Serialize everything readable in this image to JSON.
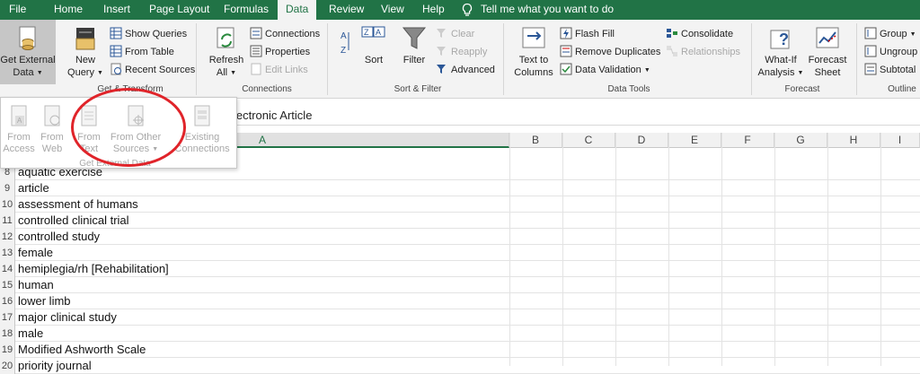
{
  "menu": {
    "tabs": [
      "File",
      "Home",
      "Insert",
      "Page Layout",
      "Formulas",
      "Data",
      "Review",
      "View",
      "Help"
    ],
    "active": "Data",
    "tell_me": "Tell me what you want to do"
  },
  "ribbon": {
    "get_external": {
      "line1": "Get External",
      "line2": "Data"
    },
    "new_query": {
      "line1": "New",
      "line2": "Query"
    },
    "show_queries": "Show Queries",
    "from_table": "From Table",
    "recent_sources": "Recent Sources",
    "group_get_transform": "Get & Transform",
    "refresh": {
      "line1": "Refresh",
      "line2": "All"
    },
    "connections": "Connections",
    "properties": "Properties",
    "edit_links": "Edit Links",
    "group_connections": "Connections",
    "sort_az": "A↓Z",
    "sort": "Sort",
    "filter": "Filter",
    "clear": "Clear",
    "reapply": "Reapply",
    "advanced": "Advanced",
    "group_sort_filter": "Sort & Filter",
    "text_to_columns": {
      "line1": "Text to",
      "line2": "Columns"
    },
    "flash_fill": "Flash Fill",
    "remove_duplicates": "Remove Duplicates",
    "data_validation": "Data Validation",
    "consolidate": "Consolidate",
    "relationships": "Relationships",
    "group_data_tools": "Data Tools",
    "what_if": {
      "line1": "What-If",
      "line2": "Analysis"
    },
    "forecast_sheet": {
      "line1": "Forecast",
      "line2": "Sheet"
    },
    "group_forecast": "Forecast",
    "group_btn": "Group",
    "ungroup_btn": "Ungroup",
    "subtotal_btn": "Subtotal",
    "group_outline": "Outline"
  },
  "dropdown": {
    "from_access": {
      "line1": "From",
      "line2": "Access"
    },
    "from_web": {
      "line1": "From",
      "line2": "Web"
    },
    "from_text": {
      "line1": "From",
      "line2": "Text"
    },
    "from_other": {
      "line1": "From Other",
      "line2": "Sources"
    },
    "existing": {
      "line1": "Existing",
      "line2": "Connections"
    },
    "group_label": "Get External Data"
  },
  "formula_bar": {
    "content": "lectronic Article"
  },
  "columns": [
    "A",
    "B",
    "C",
    "D",
    "E",
    "F",
    "G",
    "H",
    "I"
  ],
  "rows": [
    {
      "num": "8",
      "value": "aquatic exercise"
    },
    {
      "num": "9",
      "value": "article"
    },
    {
      "num": "10",
      "value": "assessment of humans"
    },
    {
      "num": "11",
      "value": "controlled clinical trial"
    },
    {
      "num": "12",
      "value": "controlled study"
    },
    {
      "num": "13",
      "value": "female"
    },
    {
      "num": "14",
      "value": "hemiplegia/rh [Rehabilitation]"
    },
    {
      "num": "15",
      "value": "human"
    },
    {
      "num": "16",
      "value": "lower limb"
    },
    {
      "num": "17",
      "value": "major clinical study"
    },
    {
      "num": "18",
      "value": "male"
    },
    {
      "num": "19",
      "value": "Modified Ashworth Scale"
    },
    {
      "num": "20",
      "value": "priority journal"
    }
  ],
  "colors": {
    "brand": "#217346",
    "highlight_circle": "#e0242a"
  }
}
